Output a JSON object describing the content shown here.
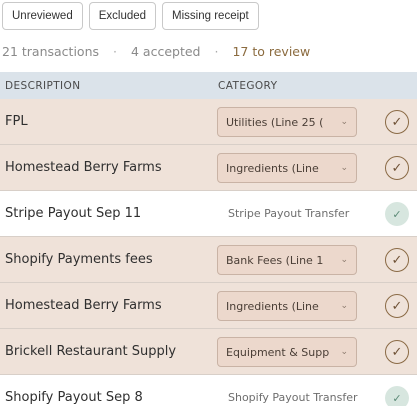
{
  "filters": [
    "Unreviewed",
    "Excluded",
    "Missing receipt"
  ],
  "summary": {
    "transactions": "21 transactions",
    "accepted": "4 accepted",
    "to_review": "17 to review"
  },
  "table": {
    "headers": {
      "description": "DESCRIPTION",
      "category": "CATEGORY"
    },
    "rows": [
      {
        "description": "FPL",
        "category": "Utilities  (Line 25 (",
        "status": "review"
      },
      {
        "description": "Homestead Berry Farms",
        "category": "Ingredients  (Line",
        "status": "review"
      },
      {
        "description": "Stripe Payout Sep 11",
        "category": "Stripe Payout Transfer",
        "status": "accepted"
      },
      {
        "description": "Shopify Payments fees",
        "category": "Bank Fees  (Line 1",
        "status": "review"
      },
      {
        "description": "Homestead Berry Farms",
        "category": "Ingredients  (Line",
        "status": "review"
      },
      {
        "description": "Brickell Restaurant Supply",
        "category": "Equipment & Supp",
        "status": "review"
      },
      {
        "description": "Shopify Payout Sep 8",
        "category": "Shopify Payout Transfer",
        "status": "accepted"
      }
    ]
  },
  "icons": {
    "chevron": "chevron-down-icon",
    "check": "checkmark-icon"
  },
  "colors": {
    "review_row": "#efe2d9",
    "header": "#dbe3ea",
    "accent": "#8b6b3f"
  }
}
